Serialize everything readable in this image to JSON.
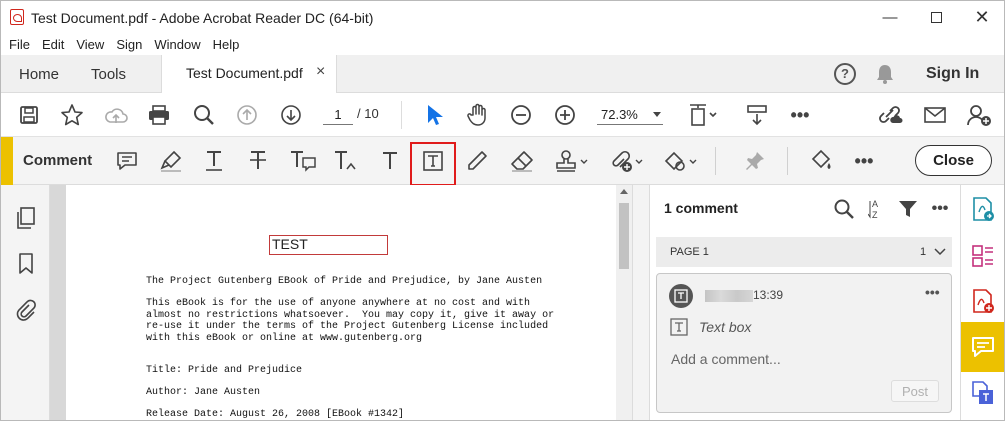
{
  "window": {
    "title": "Test Document.pdf - Adobe Acrobat Reader DC (64-bit)"
  },
  "menu": [
    "File",
    "Edit",
    "View",
    "Sign",
    "Window",
    "Help"
  ],
  "tabs": {
    "home": "Home",
    "tools": "Tools",
    "document": "Test Document.pdf",
    "close": "×",
    "sign_in": "Sign In"
  },
  "toolbar": {
    "page_current": "1",
    "page_total": "/ 10",
    "zoom": "72.3%"
  },
  "comment_toolbar": {
    "label": "Comment",
    "close": "Close"
  },
  "document": {
    "textbox": "TEST",
    "line1": "The Project Gutenberg EBook of Pride and Prejudice, by Jane Austen",
    "para": "This eBook is for the use of anyone anywhere at no cost and with\nalmost no restrictions whatsoever.  You may copy it, give it away or\nre-use it under the terms of the Project Gutenberg License included\nwith this eBook or online at www.gutenberg.org",
    "title": "Title: Pride and Prejudice",
    "author": "Author: Jane Austen",
    "release": "Release Date: August 26, 2008 [EBook #1342]"
  },
  "comments_panel": {
    "count": "1 comment",
    "page_label": "PAGE 1",
    "page_count": "1",
    "time": "13:39",
    "comment_type": "Text box",
    "reply_placeholder": "Add a comment...",
    "post": "Post"
  },
  "colors": {
    "accent": "#ecc100",
    "highlight_box": "#e01b1b",
    "select_tool": "#1473e6",
    "pdf_red": "#d0271d"
  }
}
